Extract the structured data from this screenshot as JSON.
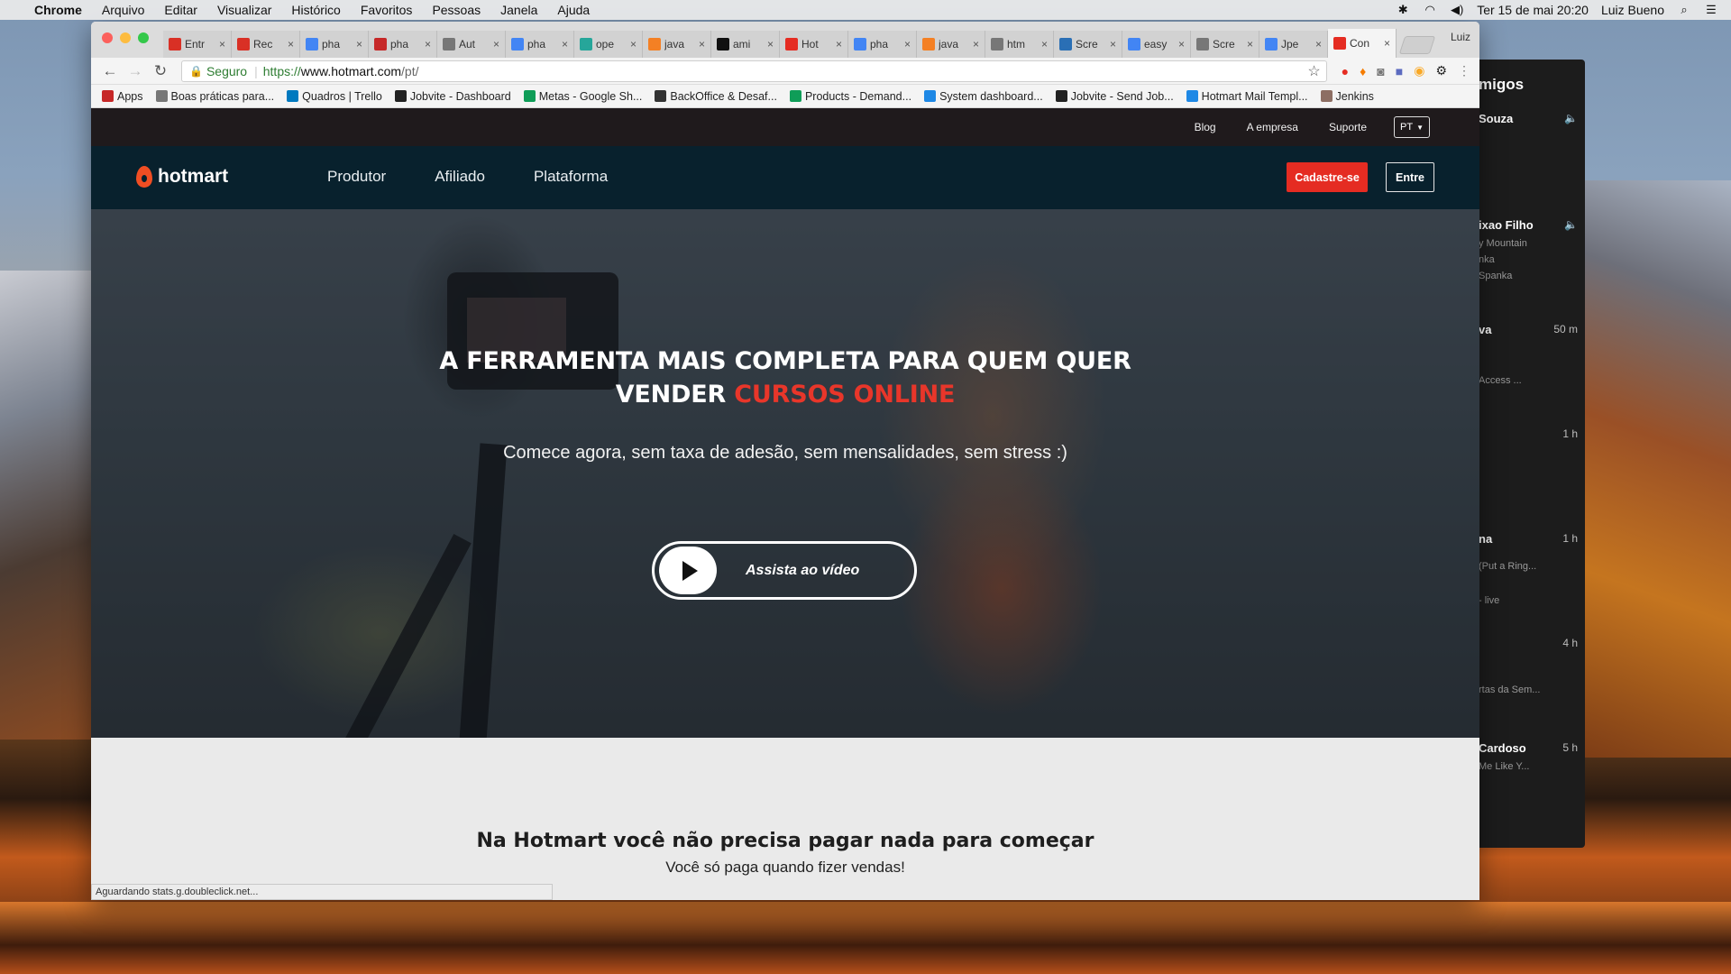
{
  "menubar": {
    "app": "Chrome",
    "items": [
      "Arquivo",
      "Editar",
      "Visualizar",
      "Histórico",
      "Favoritos",
      "Pessoas",
      "Janela",
      "Ajuda"
    ],
    "datetime": "Ter 15 de mai  20:20",
    "user": "Luiz Bueno"
  },
  "tabs": [
    {
      "icon": "gmail-icon",
      "label": "Entr",
      "color": "#d93025"
    },
    {
      "icon": "red-doc-icon",
      "label": "Rec",
      "color": "#d93025"
    },
    {
      "icon": "google-icon",
      "label": "pha",
      "color": "#4285f4"
    },
    {
      "icon": "red-doc-icon",
      "label": "pha",
      "color": "#c62828"
    },
    {
      "icon": "page-icon",
      "label": "Aut",
      "color": "#777"
    },
    {
      "icon": "google-icon",
      "label": "pha",
      "color": "#4285f4"
    },
    {
      "icon": "blob-icon",
      "label": "ope",
      "color": "#26a69a"
    },
    {
      "icon": "stack-icon",
      "label": "java",
      "color": "#f48024"
    },
    {
      "icon": "github-icon",
      "label": "ami",
      "color": "#111"
    },
    {
      "icon": "hotmart-icon",
      "label": "Hot",
      "color": "#e52c22"
    },
    {
      "icon": "google-icon",
      "label": "pha",
      "color": "#4285f4"
    },
    {
      "icon": "stack-icon",
      "label": "java",
      "color": "#f48024"
    },
    {
      "icon": "page-icon",
      "label": "htm",
      "color": "#777"
    },
    {
      "icon": "w3-icon",
      "label": "Scre",
      "color": "#2a6fb5"
    },
    {
      "icon": "google-icon",
      "label": "easy",
      "color": "#4285f4"
    },
    {
      "icon": "puzzle-icon",
      "label": "Scre",
      "color": "#777"
    },
    {
      "icon": "google-icon",
      "label": "Jpe",
      "color": "#4285f4"
    },
    {
      "icon": "hotmart-icon",
      "label": "Con",
      "color": "#e52c22"
    }
  ],
  "profile_label": "Luiz",
  "omnibox": {
    "secure_label": "Seguro",
    "url_protocol": "https://",
    "url_host": "www.hotmart.com",
    "url_path": "/pt/"
  },
  "bookmarks": [
    {
      "icon": "apps-icon",
      "label": "Apps"
    },
    {
      "icon": "loading-icon",
      "label": "Boas práticas para..."
    },
    {
      "icon": "trello-icon",
      "label": "Quadros | Trello"
    },
    {
      "icon": "jobvite-icon",
      "label": "Jobvite - Dashboard"
    },
    {
      "icon": "sheets-icon",
      "label": "Metas - Google Sh..."
    },
    {
      "icon": "backoffice-icon",
      "label": "BackOffice & Desaf..."
    },
    {
      "icon": "sheets-icon",
      "label": "Products - Demand..."
    },
    {
      "icon": "diamond-icon",
      "label": "System dashboard..."
    },
    {
      "icon": "jobvite-icon",
      "label": "Jobvite - Send Job..."
    },
    {
      "icon": "tx-icon",
      "label": "Hotmart Mail Templ..."
    },
    {
      "icon": "jenkins-icon",
      "label": "Jenkins"
    }
  ],
  "site": {
    "top_links": [
      "Blog",
      "A empresa",
      "Suporte"
    ],
    "lang": "PT",
    "brand": "hotmart",
    "nav": [
      "Produtor",
      "Afiliado",
      "Plataforma"
    ],
    "signup": "Cadastre-se",
    "login": "Entre",
    "hero_line1": "A FERRAMENTA MAIS COMPLETA PARA QUEM QUER",
    "hero_line2a": "VENDER ",
    "hero_line2b": "CURSOS ONLINE",
    "hero_sub": "Comece agora, sem taxa de adesão, sem mensalidades, sem stress :)",
    "video_label": "Assista ao vídeo",
    "section_title": "Na Hotmart você não precisa pagar nada para começar",
    "section_sub": "Você só paga quando fizer vendas!"
  },
  "status_text": "Aguardando stats.g.doubleclick.net...",
  "side_window": {
    "header": "migos",
    "friends": [
      {
        "name": "Souza",
        "sub": "",
        "time": "speaker"
      },
      {
        "name": "ixao Filho",
        "sub": "y Mountain\nnka\nSpanka",
        "time": "speaker"
      },
      {
        "name": "va",
        "sub": "Access ...",
        "time": "50 m"
      },
      {
        "name": "",
        "sub": "",
        "time": "1 h"
      },
      {
        "name": "na",
        "sub": "(Put a Ring...\n- live",
        "time": "1 h"
      },
      {
        "name": "",
        "sub": "rtas da Sem...",
        "time": "4 h"
      },
      {
        "name": "Cardoso",
        "sub": "Me Like Y...",
        "time": "5 h"
      }
    ]
  },
  "colors": {
    "brand_red": "#e52c22",
    "nav_bg": "#08212d",
    "top_strip": "#1f1a1c"
  }
}
